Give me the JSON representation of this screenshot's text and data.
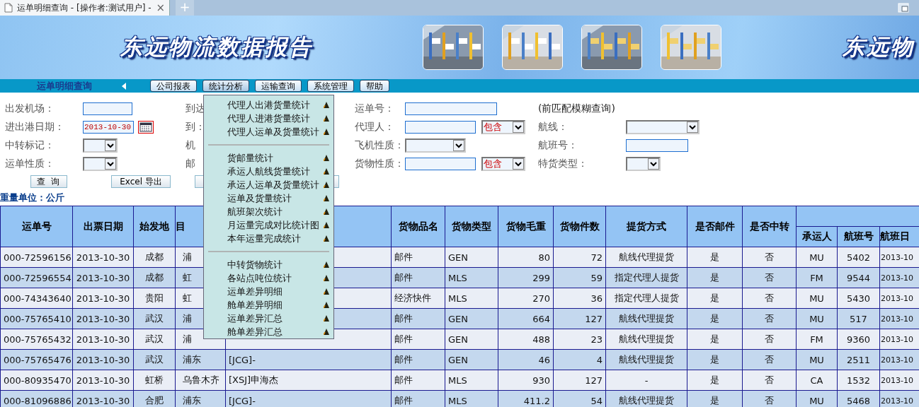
{
  "browser_tab": {
    "title": "运单明细查询 - [操作者:测试用户] -",
    "close": "×",
    "new_tab": "+"
  },
  "banner": {
    "logo": "东远物流数据报告",
    "logo_repeat": "东远物"
  },
  "nav": {
    "page_title": "运单明细查询",
    "menus": [
      {
        "label": "公司报表",
        "selected": false
      },
      {
        "label": "统计分析",
        "selected": true
      },
      {
        "label": "运输查询",
        "selected": false
      },
      {
        "label": "系统管理",
        "selected": false
      },
      {
        "label": "帮助",
        "selected": false
      }
    ]
  },
  "form": {
    "fields": [
      {
        "label": "出发机场：",
        "kind": "input"
      },
      {
        "label": "到达",
        "kind": "covered"
      },
      {
        "label": "运单号：",
        "kind": "input_wide"
      },
      {
        "label": "(前匹配模糊查询)",
        "kind": "note"
      },
      {
        "label": "进出港日期：",
        "kind": "date",
        "value": "2013-10-30"
      },
      {
        "label": "到：",
        "kind": "covered"
      },
      {
        "label": "代理人：",
        "kind": "input_select",
        "select_value": "包含"
      },
      {
        "label": "航线：",
        "kind": "select_wide"
      },
      {
        "label": "中转标记：",
        "kind": "select"
      },
      {
        "label": "机",
        "kind": "covered"
      },
      {
        "label": "飞机性质：",
        "kind": "select_mid"
      },
      {
        "label": "航班号：",
        "kind": "input_mid"
      },
      {
        "label": "运单性质：",
        "kind": "select"
      },
      {
        "label": "邮",
        "kind": "covered"
      },
      {
        "label": "货物性质：",
        "kind": "input_select",
        "select_value": "包含"
      },
      {
        "label": "特货类型：",
        "kind": "select"
      }
    ],
    "buttons": [
      {
        "kind": "text",
        "label": "查 询"
      },
      {
        "kind": "text",
        "label": "Excel 导出"
      },
      {
        "kind": "covered"
      }
    ],
    "unit_note": "重量单位：公斤"
  },
  "menu": {
    "groups": [
      {
        "items": [
          "代理人出港货量统计",
          "代理人进港货量统计",
          "代理人运单及货量统计"
        ]
      },
      {
        "items": [
          "货邮量统计",
          "承运人航线货量统计",
          "承运人运单及货量统计",
          "运单及货量统计",
          "航班架次统计",
          "月运量完成对比统计图",
          "本年运量完成统计"
        ]
      },
      {
        "items": [
          "中转货物统计",
          "各站点吨位统计",
          "运单差异明细",
          "舱单差异明细",
          "运单差异汇总",
          "舱单差异汇总"
        ]
      }
    ]
  },
  "table": {
    "columns": [
      {
        "label": "运单号",
        "grouped": false
      },
      {
        "label": "出票日期",
        "grouped": false
      },
      {
        "label": "始发地",
        "grouped": false
      },
      {
        "label": "目",
        "grouped": false
      },
      {
        "grouped": false
      },
      {
        "label": "货物品名",
        "grouped": false
      },
      {
        "label": "货物类型",
        "grouped": false
      },
      {
        "label": "货物毛重",
        "grouped": false
      },
      {
        "label": "货物件数",
        "grouped": false
      },
      {
        "label": "提货方式",
        "grouped": false
      },
      {
        "label": "是否邮件",
        "grouped": false
      },
      {
        "label": "是否中转",
        "grouped": false
      },
      {
        "label": "承运人",
        "grouped": true
      },
      {
        "label": "航班号",
        "grouped": true
      },
      {
        "label": "航班日",
        "grouped": true
      }
    ],
    "rows": [
      [
        "000-72596156",
        "2013-10-30",
        "成都",
        "浦",
        null,
        "邮件",
        "GEN",
        "80",
        "72",
        "航线代理提货",
        "是",
        "否",
        "MU",
        "5402",
        "2013-10"
      ],
      [
        "000-72596554",
        "2013-10-30",
        "成都",
        "虹",
        null,
        "邮件",
        "MLS",
        "299",
        "59",
        "指定代理人提货",
        "是",
        "否",
        "FM",
        "9544",
        "2013-10"
      ],
      [
        "000-74343640",
        "2013-10-30",
        "贵阳",
        "虹",
        null,
        "经济快件",
        "MLS",
        "270",
        "36",
        "指定代理人提货",
        "是",
        "否",
        "MU",
        "5430",
        "2013-10"
      ],
      [
        "000-75765410",
        "2013-10-30",
        "武汉",
        "浦",
        null,
        "邮件",
        "GEN",
        "664",
        "127",
        "航线代理提货",
        "是",
        "否",
        "MU",
        "517",
        "2013-10"
      ],
      [
        "000-75765432",
        "2013-10-30",
        "武汉",
        "浦",
        null,
        "邮件",
        "GEN",
        "488",
        "23",
        "航线代理提货",
        "是",
        "否",
        "FM",
        "9360",
        "2013-10"
      ],
      [
        "000-75765476",
        "2013-10-30",
        "武汉",
        "浦东",
        "[JCG]-",
        "邮件",
        "GEN",
        "46",
        "4",
        "航线代理提货",
        "是",
        "否",
        "MU",
        "2511",
        "2013-10"
      ],
      [
        "000-80935470",
        "2013-10-30",
        "虹桥",
        "乌鲁木齐",
        "[XSJ]申海杰",
        "邮件",
        "MLS",
        "930",
        "127",
        "-",
        "是",
        "否",
        "CA",
        "1532",
        "2013-10"
      ],
      [
        "000-81096886",
        "2013-10-30",
        "合肥",
        "浦东",
        "[JCG]-",
        "邮件",
        "MLS",
        "411.2",
        "54",
        "航线代理提货",
        "是",
        "否",
        "MU",
        "5468",
        "2013-10"
      ]
    ]
  }
}
